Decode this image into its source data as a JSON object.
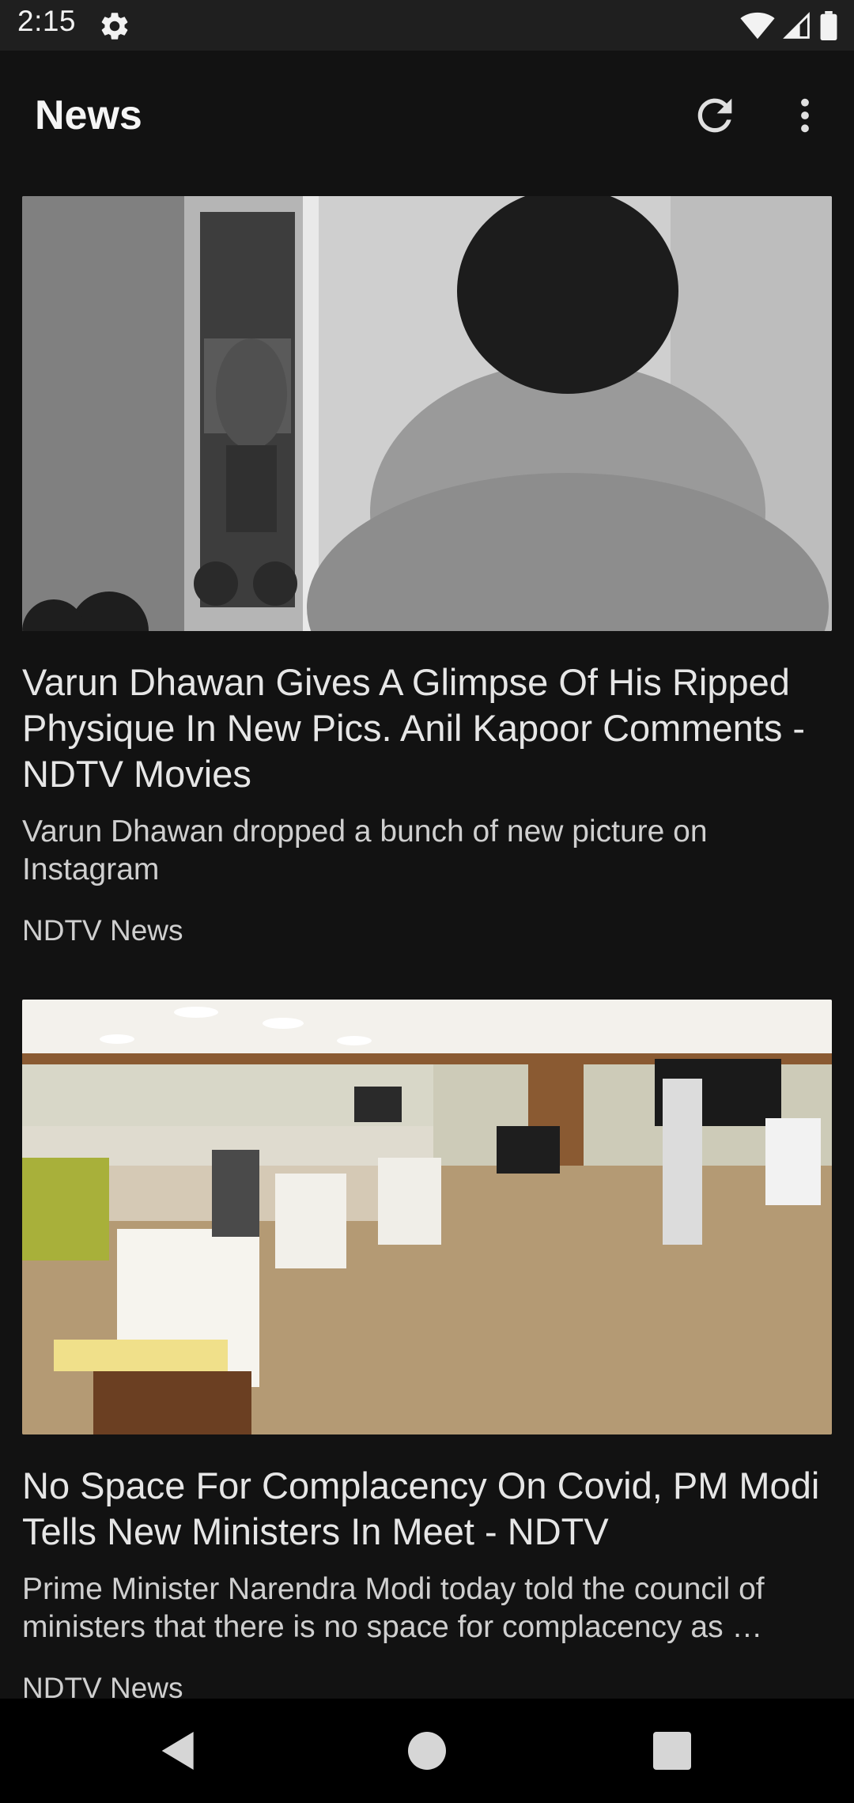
{
  "status_bar": {
    "time": "2:15",
    "icons": [
      "settings-gear-icon",
      "wifi-icon",
      "signal-icon",
      "battery-icon"
    ]
  },
  "app_bar": {
    "title": "News",
    "actions": [
      "refresh-icon",
      "more-vert-icon"
    ]
  },
  "articles": [
    {
      "title": "Varun Dhawan Gives A Glimpse Of His Ripped Physique In New Pics. Anil Kapoor Comments - NDTV Movies",
      "description": "Varun Dhawan dropped a bunch of new picture on Instagram",
      "source": "NDTV News"
    },
    {
      "title": "No Space For Complacency On Covid, PM Modi Tells New Ministers In Meet - NDTV",
      "description": "Prime Minister Narendra Modi today told the council of ministers that there is no space for complacency as …",
      "source": "NDTV News"
    }
  ],
  "nav_bar": {
    "buttons": [
      "back-icon",
      "home-icon",
      "recents-icon"
    ]
  },
  "colors": {
    "background": "#121212",
    "status_bar": "#1f1f1f",
    "nav_bar": "#000000",
    "text_primary": "#e6e6e6"
  }
}
